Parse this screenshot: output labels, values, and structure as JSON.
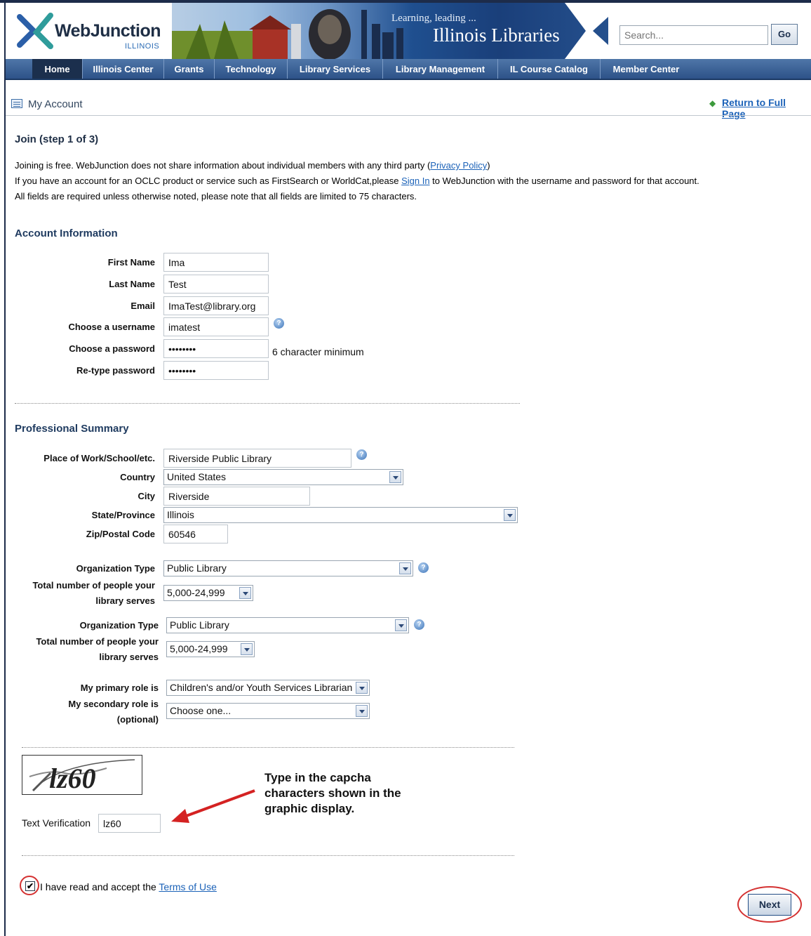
{
  "header": {
    "logo_text": "WebJunction",
    "logo_sub": "ILLINOIS",
    "tagline": "Learning, leading ...",
    "banner_title": "Illinois Libraries",
    "search_placeholder": "Search...",
    "go_label": "Go"
  },
  "nav": {
    "items": [
      {
        "label": "Home"
      },
      {
        "label": "Illinois Center"
      },
      {
        "label": "Grants"
      },
      {
        "label": "Technology"
      },
      {
        "label": "Library Services"
      },
      {
        "label": "Library Management"
      },
      {
        "label": "IL Course Catalog"
      },
      {
        "label": "Member Center"
      }
    ]
  },
  "account": {
    "title": "My Account",
    "return_link": "Return to Full Page"
  },
  "join": {
    "heading": "Join (step 1 of 3)",
    "line1_text": "Joining is free. WebJunction does not share information about individual members with any third party (",
    "line1_link": "Privacy Policy",
    "line1_end": ")",
    "line2_text": "If you have an account for an OCLC product or service such as FirstSearch or WorldCat,please ",
    "line2_link": "Sign In",
    "line2_end": " to WebJunction with the username and password for that account.",
    "line3": "All fields are required unless otherwise noted, please note that all fields are limited to 75 characters."
  },
  "account_info": {
    "heading": "Account Information",
    "first_name_label": "First Name",
    "first_name": "Ima",
    "last_name_label": "Last Name",
    "last_name": "Test",
    "email_label": "Email",
    "email": "ImaTest@library.org",
    "username_label": "Choose a username",
    "username": "imatest",
    "password_label": "Choose a password",
    "password": "••••••••",
    "password_hint": "6 character minimum",
    "retype_label": "Re-type password",
    "retype": "••••••••"
  },
  "professional": {
    "heading": "Professional Summary",
    "workplace_label": "Place of Work/School/etc.",
    "workplace": "Riverside Public Library",
    "country_label": "Country",
    "country": "United States",
    "city_label": "City",
    "city": "Riverside",
    "state_label": "State/Province",
    "state": "Illinois",
    "zip_label": "Zip/Postal Code",
    "zip": "60546",
    "org_type_label": "Organization Type",
    "org_type": "Public Library",
    "people_label_1": "Total number of people your",
    "people_label_2": "library serves",
    "people": "5,000-24,999",
    "org_type2_label": "Organization Type",
    "org_type2": "Public Library",
    "people2_label_1": "Total number of people your",
    "people2_label_2": "library serves",
    "people2": "5,000-24,999",
    "primary_role_label": "My primary role is",
    "primary_role": "Children's and/or Youth Services Librarian",
    "secondary_role_label_1": "My secondary role is",
    "secondary_role_label_2": "(optional)",
    "secondary_role": "Choose one..."
  },
  "captcha": {
    "image_text": "lz60",
    "label": "Text Verification",
    "value": "lz60",
    "callout_1": "Type in the capcha",
    "callout_2": "characters shown in the",
    "callout_3": "graphic display."
  },
  "terms": {
    "text": "I have read and accept the ",
    "link": "Terms of Use",
    "checked_mark": "✔"
  },
  "next_label": "Next"
}
